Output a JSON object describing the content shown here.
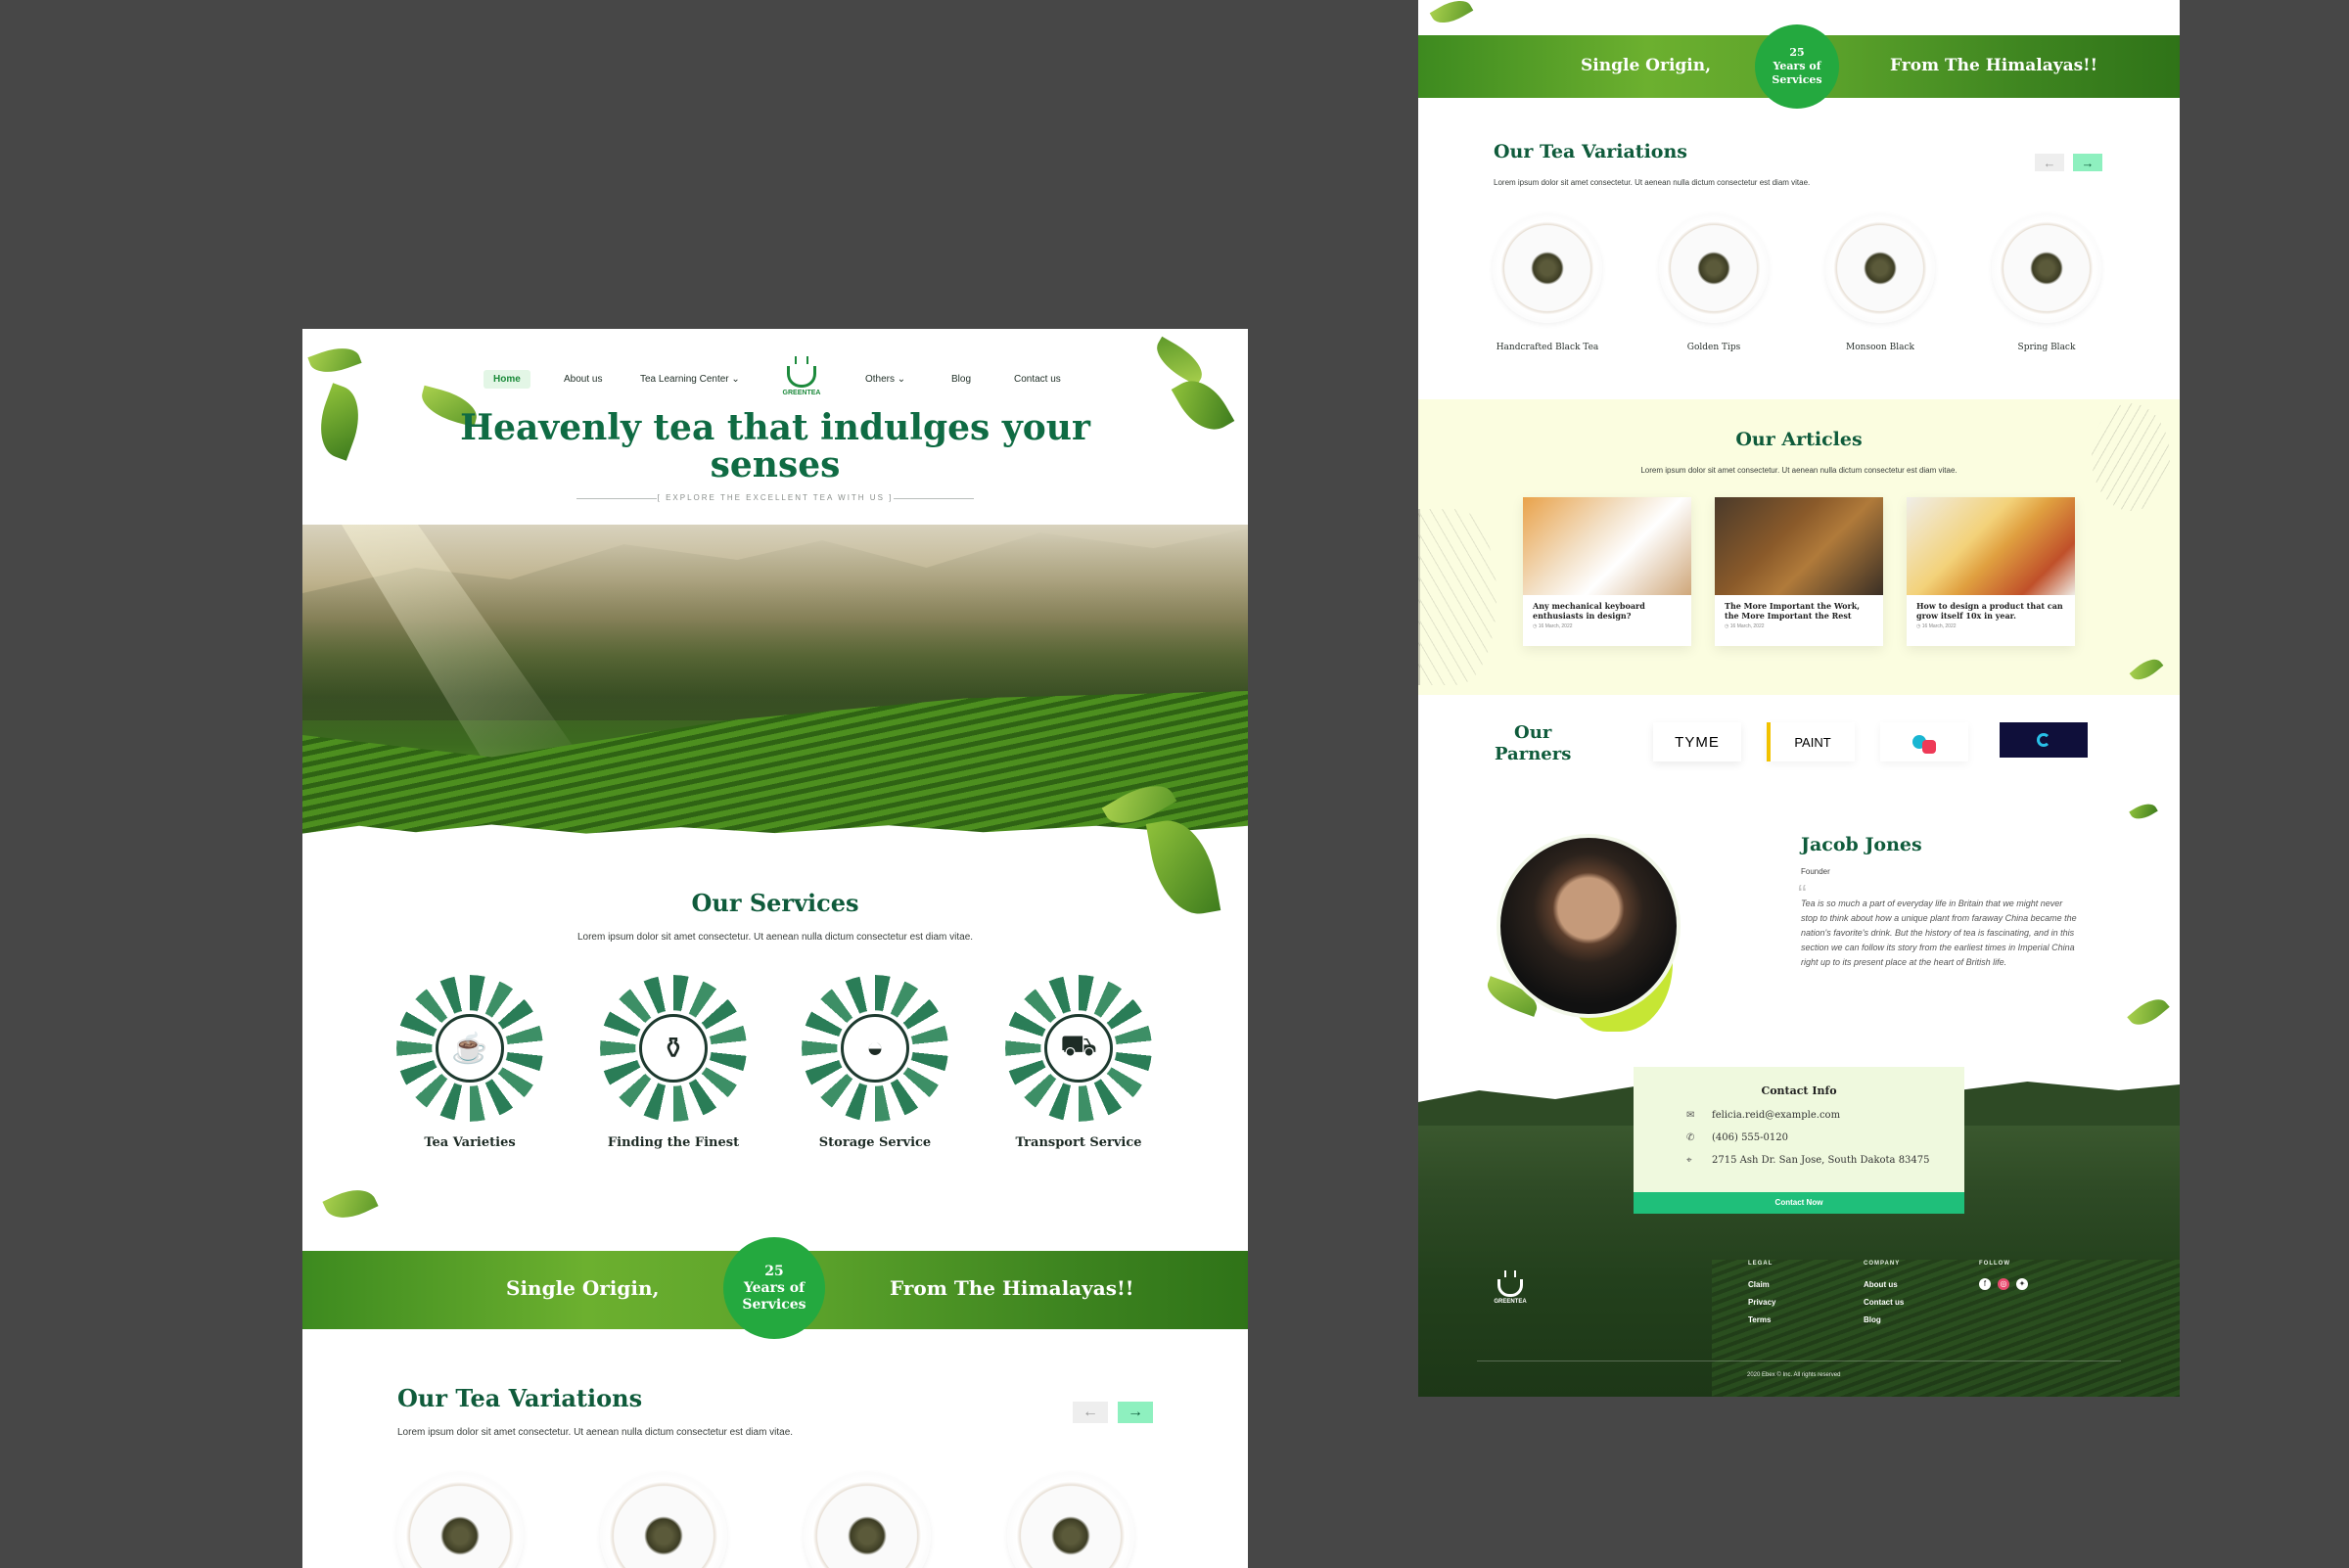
{
  "left": {
    "nav": {
      "home": "Home",
      "about": "About us",
      "learning": "Tea Learning Center",
      "others": "Others",
      "blog": "Blog",
      "contact": "Contact us",
      "logo_text": "GREENTEA"
    },
    "hero": {
      "title_line1": "Heavenly tea that indulges your",
      "title_line2": "senses",
      "subtitle": "[ EXPLORE THE EXCELLENT TEA WITH US ]"
    },
    "services": {
      "title": "Our Services",
      "desc": "Lorem ipsum dolor sit amet consectetur. Ut aenean nulla dictum consectetur est diam vitae.",
      "items": [
        {
          "label": "Tea Varieties",
          "icon": "teacup-icon"
        },
        {
          "label": "Finding the Finest",
          "icon": "kettle-icon"
        },
        {
          "label": "Storage Service",
          "icon": "tea-sack-icon"
        },
        {
          "label": "Transport Service",
          "icon": "truck-icon"
        }
      ]
    },
    "banner": {
      "left": "Single Origin,",
      "right": "From The Himalayas!!",
      "badge_line1": "25",
      "badge_line2": "Years of",
      "badge_line3": "Services"
    },
    "variations": {
      "title": "Our Tea Variations",
      "desc": "Lorem ipsum dolor sit amet consectetur. Ut aenean nulla dictum consectetur est diam vitae.",
      "prev": "←",
      "next": "→"
    }
  },
  "right": {
    "banner": {
      "left": "Single Origin,",
      "right": "From The Himalayas!!",
      "badge_line1": "25",
      "badge_line2": "Years of",
      "badge_line3": "Services"
    },
    "variations": {
      "title": "Our Tea Variations",
      "desc": "Lorem ipsum dolor sit amet consectetur. Ut aenean nulla dictum consectetur est diam vitae.",
      "prev": "←",
      "next": "→",
      "items": [
        "Handcrafted Black Tea",
        "Golden Tips",
        "Monsoon Black",
        "Spring Black"
      ]
    },
    "articles": {
      "title": "Our Articles",
      "desc": "Lorem ipsum dolor sit amet consectetur. Ut aenean nulla dictum consectetur est diam vitae.",
      "items": [
        {
          "title": "Any mechanical keyboard enthusiasts in design?",
          "date": "16 March, 2022"
        },
        {
          "title": "The More Important the Work, the More Important the Rest",
          "date": "16 March, 2022"
        },
        {
          "title": "How to design a product that can grow itself 10x in year.",
          "date": "16 March, 2022"
        }
      ]
    },
    "partners": {
      "title_line1": "Our",
      "title_line2": "Parners",
      "logos": [
        "TYME",
        "PAINT",
        "",
        ""
      ]
    },
    "testimonial": {
      "name": "Jacob Jones",
      "role": "Founder",
      "quote": "Tea is so much a part of everyday life in Britain that we might never stop to think about how a unique plant from faraway China became the nation's favorite's drink. But the history of tea is fascinating, and in this section we can follow its story from the earliest times in Imperial China right up to its present place at the heart of British life."
    },
    "contact": {
      "title": "Contact Info",
      "email": "felicia.reid@example.com",
      "phone": "(406) 555-0120",
      "address": "2715 Ash Dr. San Jose, South Dakota 83475",
      "button": "Contact Now"
    },
    "footer": {
      "logo_text": "GREENTEA",
      "legal": "LEGAL",
      "legal_links": [
        "Claim",
        "Privacy",
        "Terms"
      ],
      "company": "COMPANY",
      "company_links": [
        "About us",
        "Contact us",
        "Blog"
      ],
      "follow": "FOLLOW",
      "copyright": "2020 Ebex © Inc. All rights reserved"
    }
  },
  "colors": {
    "background": "#474747",
    "brand_green": "#0f5b3b",
    "accent": "#24a93f",
    "mint": "#8ef0bf",
    "cream": "#fbfde0"
  }
}
